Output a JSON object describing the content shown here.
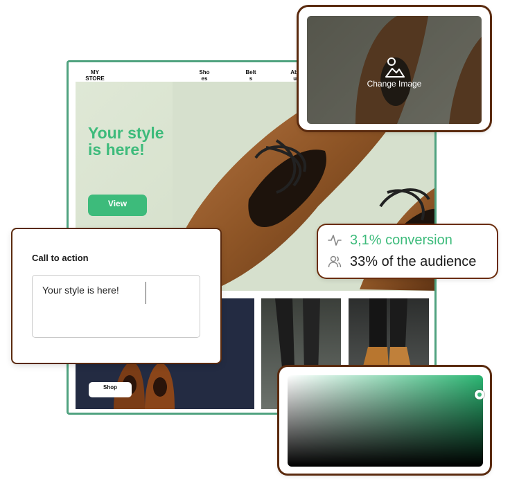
{
  "store": {
    "logo": "MY STORE",
    "nav": [
      "Shoes",
      "Belts",
      "About"
    ],
    "hero_title": "Your style is here!",
    "hero_button": "View",
    "shop_button": "Shop"
  },
  "image_card": {
    "change_label": "Change Image",
    "icon": "image-icon"
  },
  "cta_card": {
    "title": "Call to action",
    "value": "Your style is here!"
  },
  "stats": {
    "conversion": "3,1% conversion",
    "audience": "33% of the audience",
    "icons": [
      "activity-icon",
      "users-icon"
    ]
  },
  "color_picker": {
    "hue": "#2bb673",
    "handle_color": "#3db57b"
  },
  "colors": {
    "accent": "#3dbb7b",
    "frame": "#4fa27f",
    "shadow": "#5a2a0e"
  }
}
